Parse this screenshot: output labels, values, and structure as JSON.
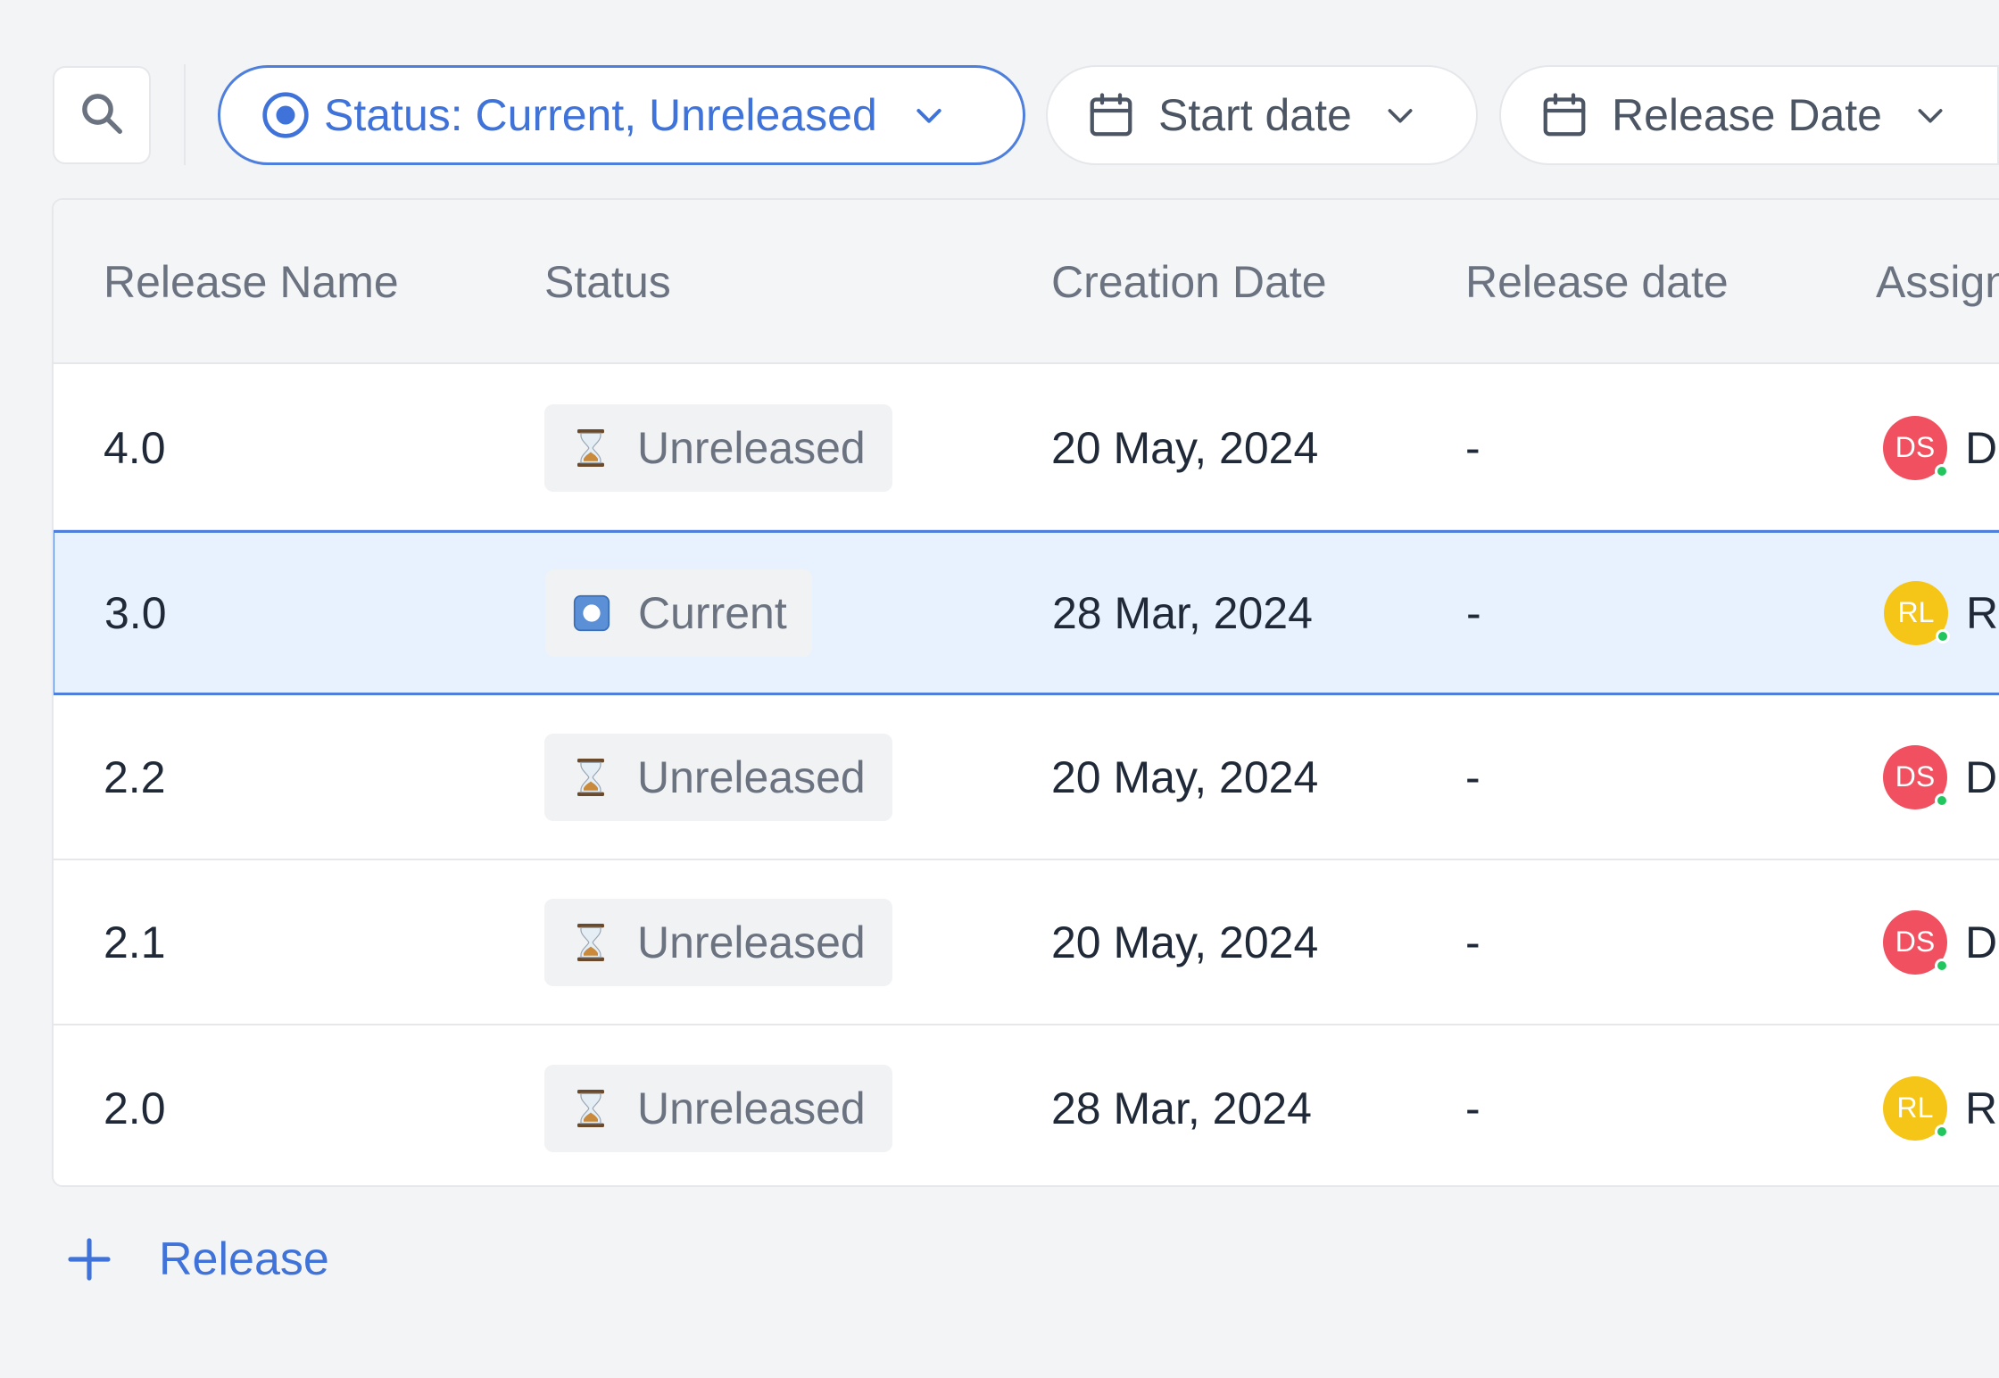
{
  "toolbar": {
    "filters": {
      "status_label": "Status: Current, Unreleased",
      "start_date_label": "Start date",
      "release_date_label": "Release Date"
    }
  },
  "table": {
    "columns": [
      "Release Name",
      "Status",
      "Creation Date",
      "Release date",
      "Assign"
    ],
    "rows": [
      {
        "name": "4.0",
        "status": "Unreleased",
        "status_icon": "hourglass-icon",
        "created": "20 May, 2024",
        "release_date": "-",
        "assignee_initials": "DS",
        "assignee_name_fragment": "D",
        "avatar_color": "#f0505f"
      },
      {
        "name": "3.0",
        "status": "Current",
        "status_icon": "record-button-icon",
        "created": "28 Mar, 2024",
        "release_date": "-",
        "assignee_initials": "RL",
        "assignee_name_fragment": "R",
        "avatar_color": "#f5c518"
      },
      {
        "name": "2.2",
        "status": "Unreleased",
        "status_icon": "hourglass-icon",
        "created": "20 May, 2024",
        "release_date": "-",
        "assignee_initials": "DS",
        "assignee_name_fragment": "D",
        "avatar_color": "#f0505f"
      },
      {
        "name": "2.1",
        "status": "Unreleased",
        "status_icon": "hourglass-icon",
        "created": "20 May, 2024",
        "release_date": "-",
        "assignee_initials": "DS",
        "assignee_name_fragment": "D",
        "avatar_color": "#f0505f"
      },
      {
        "name": "2.0",
        "status": "Unreleased",
        "status_icon": "hourglass-icon",
        "created": "28 Mar, 2024",
        "release_date": "-",
        "assignee_initials": "RL",
        "assignee_name_fragment": "R",
        "avatar_color": "#f5c518"
      }
    ]
  },
  "footer": {
    "add_release_label": "Release"
  },
  "colors": {
    "accent": "#3f73d9",
    "selected_row_bg": "#e8f1fe",
    "online_dot": "#22c55e"
  }
}
